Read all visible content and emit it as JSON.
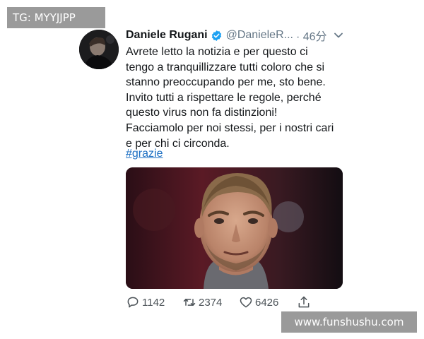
{
  "watermarks": {
    "top_left": "TG: MYYJJPP",
    "bottom_right": "www.funshushu.com"
  },
  "tweet": {
    "author_name": "Daniele Rugani",
    "handle": "@DanieleR...",
    "time": "· 46分",
    "lines": [
      "Avrete letto la notizia e per questo ci",
      "tengo a tranquillizzare tutti coloro che si",
      "stanno preoccupando per me, sto bene.",
      "Invito tutti a rispettare le regole, perché",
      "questo virus non fa distinzioni!",
      "Facciamolo per noi stessi, per i nostri cari",
      "e per chi ci circonda."
    ],
    "hashtag": "#grazie",
    "replies": "1142",
    "retweets": "2374",
    "likes": "6426"
  },
  "icons": {
    "verified": "verified-badge-icon",
    "menu": "chevron-down-icon",
    "reply": "reply-icon",
    "retweet": "retweet-icon",
    "like": "heart-icon",
    "share": "share-icon"
  },
  "colors": {
    "text": "#14171a",
    "muted": "#657786",
    "verified": "#1da1f2",
    "hashtag": "#1b6ec2",
    "watermark_bg": "#9a9a9a"
  }
}
